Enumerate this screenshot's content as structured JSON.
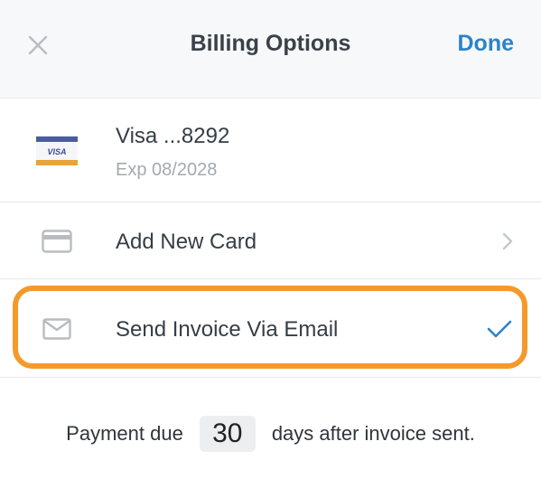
{
  "header": {
    "title": "Billing Options",
    "done_label": "Done"
  },
  "card": {
    "name": "Visa ...8292",
    "expiry": "Exp 08/2028",
    "brand_text": "VISA"
  },
  "add_card": {
    "label": "Add New Card"
  },
  "invoice": {
    "label": "Send Invoice Via Email",
    "selected": true
  },
  "payment_due": {
    "prefix": "Payment due",
    "days": "30",
    "suffix": "days after invoice sent."
  },
  "colors": {
    "accent": "#2c83c9",
    "highlight": "#f39a2c"
  },
  "icons": {
    "close": "close-icon",
    "card": "credit-card-icon",
    "email": "envelope-icon",
    "chevron": "chevron-right-icon",
    "check": "checkmark-icon"
  }
}
